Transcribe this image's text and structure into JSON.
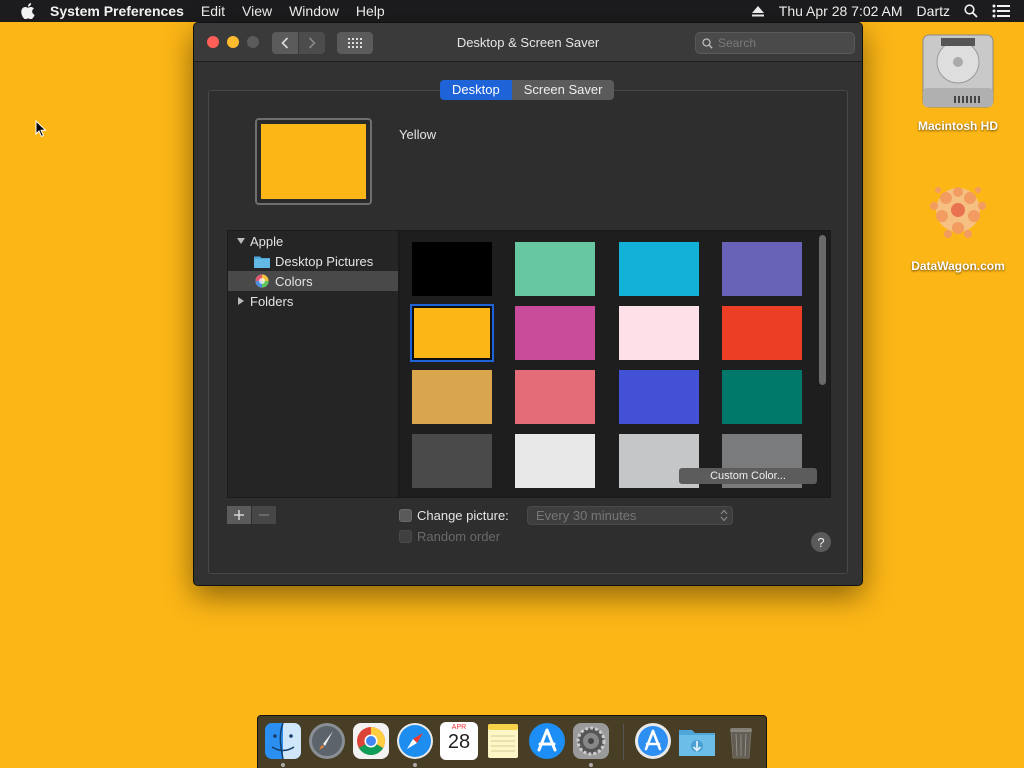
{
  "menubar": {
    "app_name": "System Preferences",
    "menus": [
      "Edit",
      "View",
      "Window",
      "Help"
    ],
    "clock": "Thu Apr 28  7:02 AM",
    "user": "Dartz"
  },
  "desktop": {
    "icons": [
      {
        "label": "Macintosh HD"
      },
      {
        "label": "DataWagon.com"
      }
    ]
  },
  "window": {
    "title": "Desktop & Screen Saver",
    "search_placeholder": "Search",
    "tabs": [
      {
        "label": "Desktop",
        "active": true
      },
      {
        "label": "Screen Saver",
        "active": false
      }
    ],
    "selected_name": "Yellow",
    "selected_color": "#FCB616",
    "sidebar": [
      {
        "label": "Apple",
        "type": "group-open"
      },
      {
        "label": "Desktop Pictures",
        "type": "folder"
      },
      {
        "label": "Colors",
        "type": "colors",
        "selected": true
      },
      {
        "label": "Folders",
        "type": "group-closed"
      }
    ],
    "swatches": [
      "#000000",
      "#66c7a0",
      "#12b1d7",
      "#6963b8",
      "#FCB616",
      "#c94c9a",
      "#fde0e8",
      "#eb3e24",
      "#d9a64e",
      "#e46c78",
      "#4251d6",
      "#00786a",
      "#4a4a4a",
      "#e8e8e8",
      "#c5c6c8",
      "#7a7b7d"
    ],
    "selected_swatch_index": 4,
    "custom_color_label": "Custom Color...",
    "change_picture_label": "Change picture:",
    "interval_value": "Every 30 minutes",
    "random_order_label": "Random order",
    "help_label": "?"
  },
  "dock": {
    "calendar_month": "APR",
    "calendar_day": "28"
  }
}
